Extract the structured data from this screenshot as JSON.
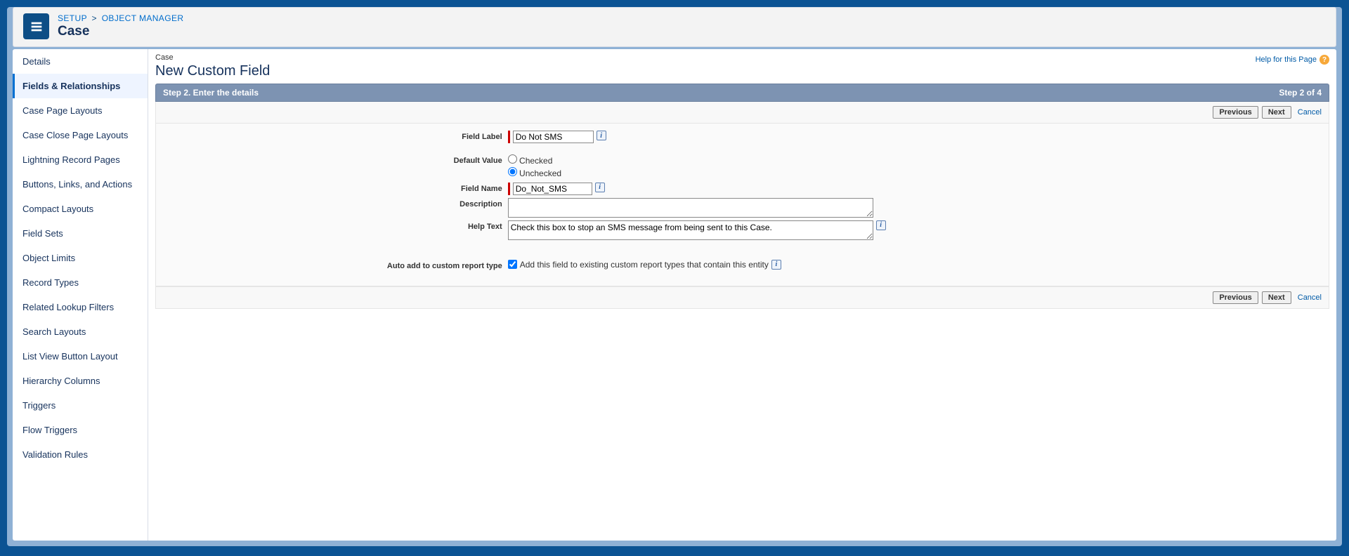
{
  "breadcrumb": {
    "setup": "Setup",
    "objmgr": "Object Manager"
  },
  "header_title": "Case",
  "sidebar": {
    "items": [
      "Details",
      "Fields & Relationships",
      "Case Page Layouts",
      "Case Close Page Layouts",
      "Lightning Record Pages",
      "Buttons, Links, and Actions",
      "Compact Layouts",
      "Field Sets",
      "Object Limits",
      "Record Types",
      "Related Lookup Filters",
      "Search Layouts",
      "List View Button Layout",
      "Hierarchy Columns",
      "Triggers",
      "Flow Triggers",
      "Validation Rules"
    ],
    "active_index": 1
  },
  "content": {
    "crumb": "Case",
    "title": "New Custom Field",
    "help_label": "Help for this Page"
  },
  "step_bar": {
    "left": "Step 2. Enter the details",
    "right": "Step 2 of 4"
  },
  "buttons": {
    "previous": "Previous",
    "next": "Next",
    "cancel": "Cancel"
  },
  "form": {
    "field_label": {
      "label": "Field Label",
      "value": "Do Not SMS"
    },
    "default_value": {
      "label": "Default Value",
      "checked": "Checked",
      "unchecked": "Unchecked",
      "selected": "unchecked"
    },
    "field_name": {
      "label": "Field Name",
      "value": "Do_Not_SMS"
    },
    "description": {
      "label": "Description",
      "value": ""
    },
    "help_text": {
      "label": "Help Text",
      "value": "Check this box to stop an SMS message from being sent to this Case."
    },
    "auto_add": {
      "label": "Auto add to custom report type",
      "checkbox_label": "Add this field to existing custom report types that contain this entity",
      "checked": true
    }
  }
}
